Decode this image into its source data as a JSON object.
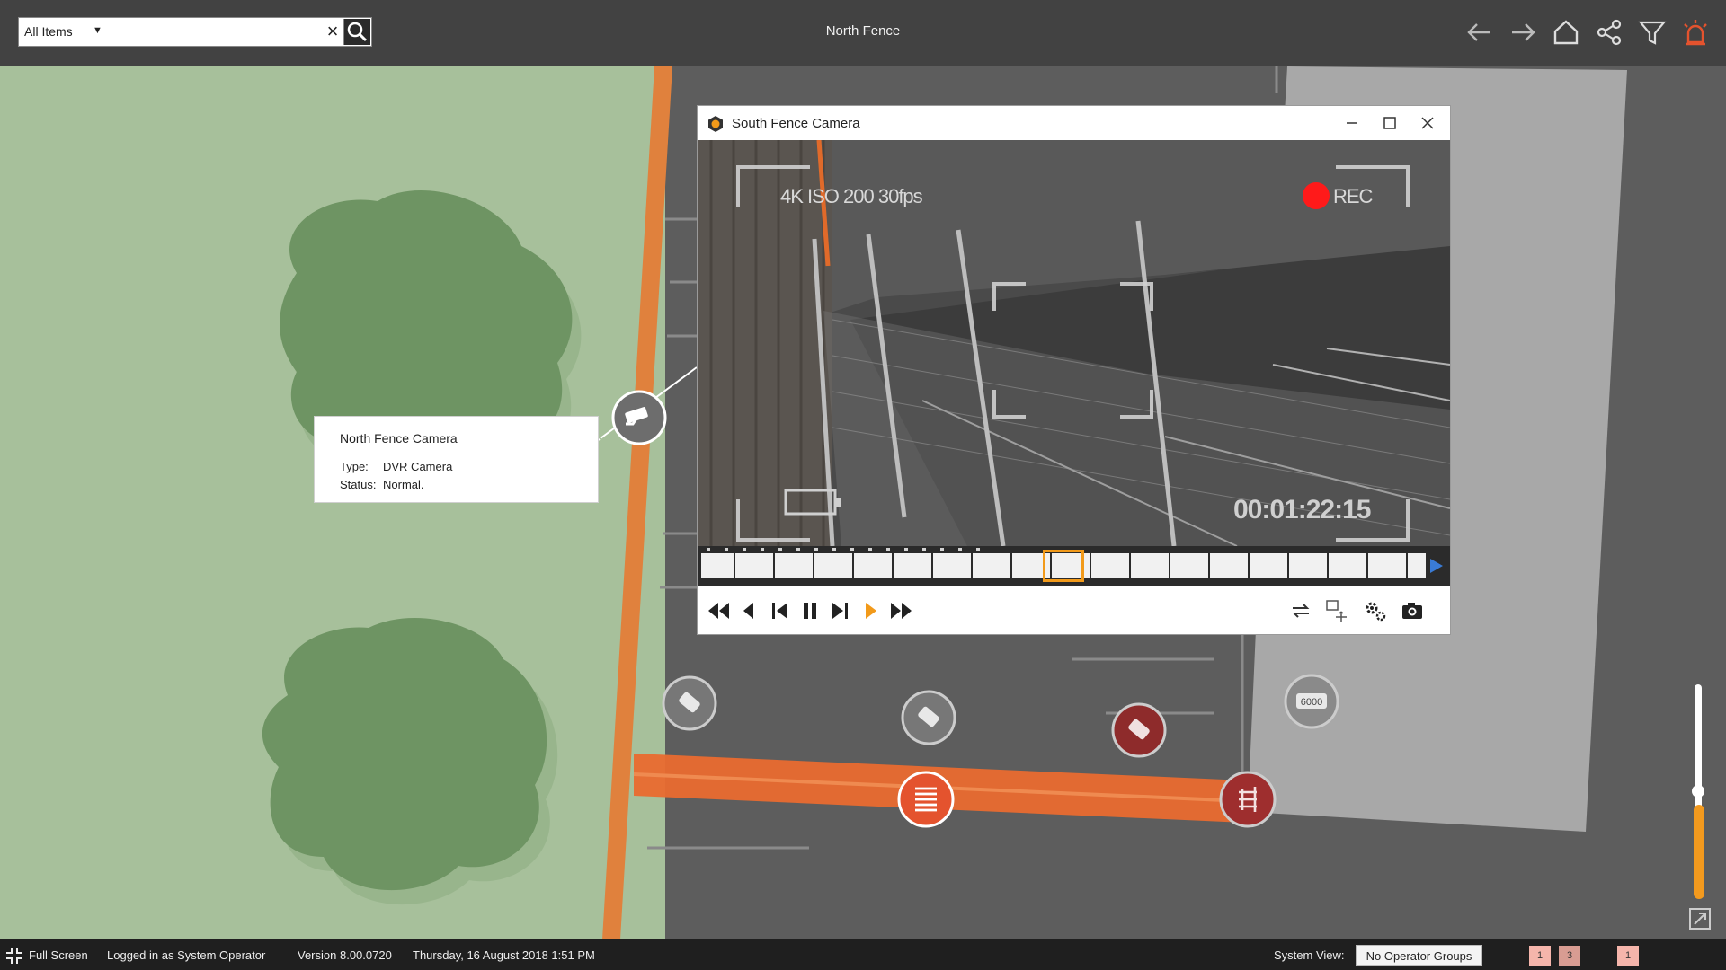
{
  "header": {
    "title": "North Fence",
    "search": {
      "scope": "All Items",
      "value": "",
      "placeholder": ""
    },
    "icons": [
      "back-arrow-icon",
      "forward-arrow-icon",
      "home-icon",
      "share-icon",
      "filter-icon",
      "alarm-icon"
    ]
  },
  "camera_window": {
    "title": "South Fence Camera",
    "osd": {
      "specs": "4K  ISO 200  30fps",
      "rec": "REC",
      "timecode": "00:01:22:15"
    },
    "timeline": {
      "position": 0.5
    },
    "controls": [
      "skip-back",
      "step-back",
      "frame-back",
      "pause",
      "frame-forward",
      "play",
      "skip-forward"
    ],
    "tools": [
      "loop",
      "ptz",
      "settings",
      "snapshot"
    ]
  },
  "tooltip": {
    "name": "North Fence Camera",
    "type_label": "Type:",
    "type_value": "DVR Camera",
    "status_label": "Status:",
    "status_value": "Normal."
  },
  "map": {
    "meter_label": "6000"
  },
  "statusbar": {
    "fullscreen": "Full Screen",
    "logged_in": "Logged in as System Operator",
    "version": "Version 8.00.0720",
    "datetime": "Thursday, 16 August 2018 1:51 PM",
    "system_view_label": "System View:",
    "system_view_value": "No Operator Groups",
    "badges": [
      "1",
      "3",
      "1"
    ]
  },
  "colors": {
    "topbar": "#424242",
    "grass": "#a7c09b",
    "tree": "#6e9463",
    "fence_orange": "#e96a2f",
    "alarm_red": "#d63a22",
    "rec_red": "#ff1a1a",
    "timeline_highlight": "#f29a1a"
  }
}
